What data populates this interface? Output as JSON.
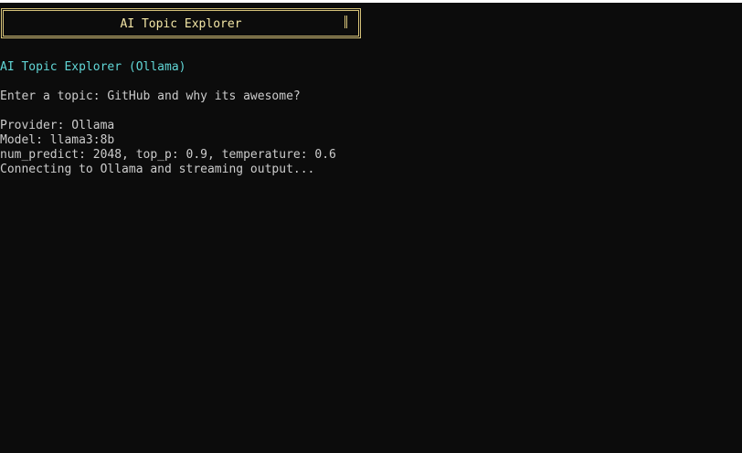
{
  "banner": {
    "title": "AI Topic Explorer"
  },
  "console": {
    "heading": "AI Topic Explorer (Ollama)",
    "prompt_line": "Enter a topic: GitHub and why its awesome?",
    "provider_line": "Provider: Ollama",
    "model_line": "Model: llama3:8b",
    "params_line": "num_predict: 2048, top_p: 0.9, temperature: 0.6",
    "status_line": "Connecting to Ollama and streaming output..."
  },
  "colors": {
    "background": "#0c0c0c",
    "text": "#cccccc",
    "heading": "#61d6d6",
    "banner_border": "#d7c37a",
    "banner_text": "#f4e7a6"
  }
}
